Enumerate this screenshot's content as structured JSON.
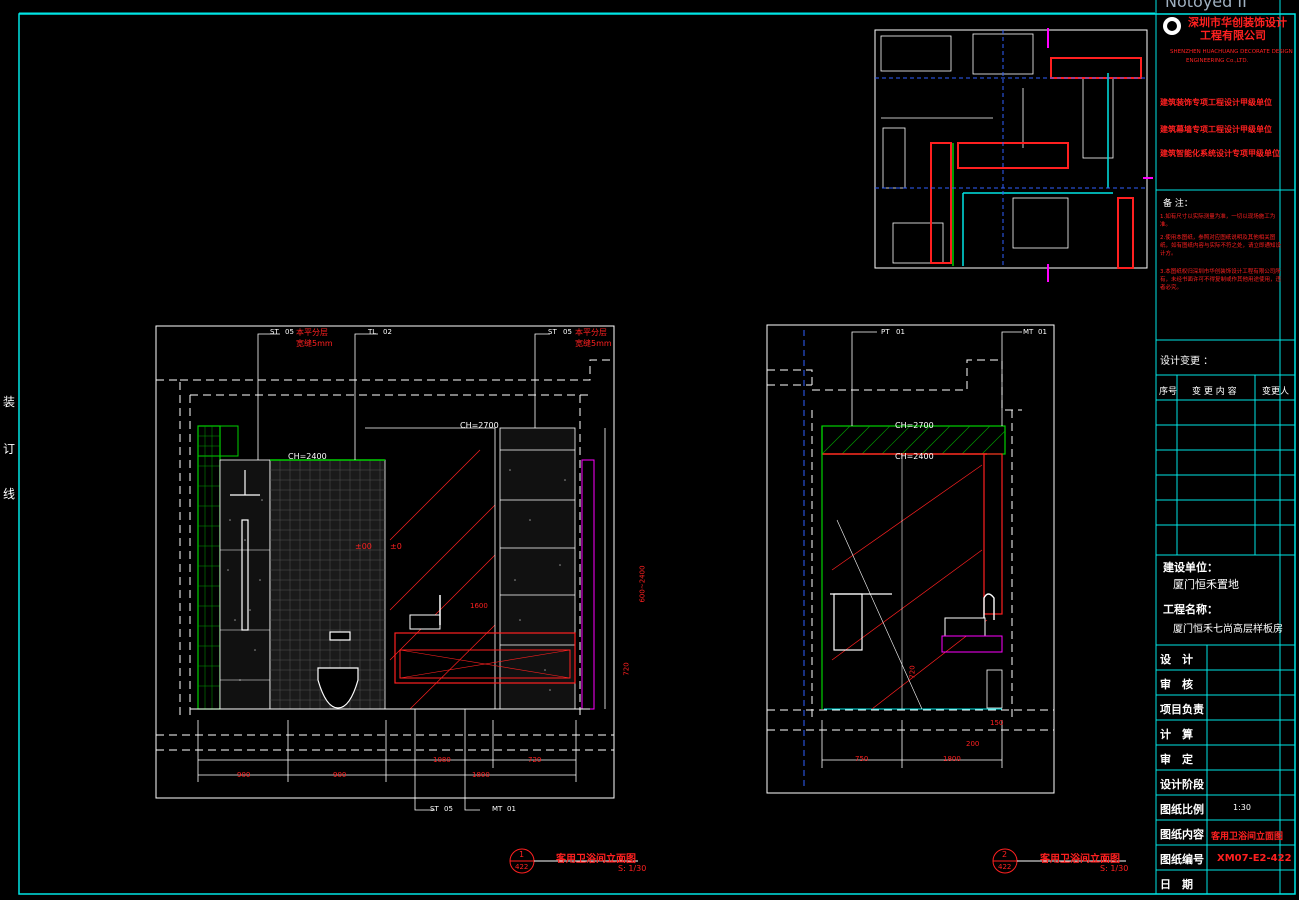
{
  "binding": {
    "c1": "装",
    "c2": "订",
    "c3": "线"
  },
  "titleblock": {
    "top_text": "Notoyed II",
    "company_cn_1": "深圳市华创装饰设计",
    "company_cn_2": "工程有限公司",
    "company_en_1": "SHENZHEN HUACHUANG DECORATE DESIGN",
    "company_en_2": "ENGINEERING Co.,LTD.",
    "approval_1": "建筑装饰专项工程设计甲级单位",
    "approval_2": "建筑幕墙专项工程设计甲级单位",
    "approval_3": "建筑智能化系统设计专项甲级单位",
    "notes_title": "备 注：",
    "note_1": "1.如有尺寸以实际测量为准，一切以现场施工为准。",
    "note_2": "2.使用本图纸，参照对应图纸说明及其他相关图纸，如有图纸内容与实际不符之处，请立即通知设计方。",
    "note_3": "3.本图纸权归深圳市华创装饰设计工程有限公司所有，未经书面许可不得复制或作其他用途使用，违者必究。",
    "change_title": "设计变更 ：",
    "change_cols": [
      "序号",
      "变 更 内 容",
      "变更人"
    ],
    "owner_label": "建设单位：",
    "owner_value": "厦门恒禾置地",
    "project_label": "工程名称：",
    "project_value": "厦门恒禾七尚高层样板房",
    "rows": [
      {
        "label": "设　计",
        "value": ""
      },
      {
        "label": "审　核",
        "value": ""
      },
      {
        "label": "项目负责",
        "value": ""
      },
      {
        "label": "计　算",
        "value": ""
      },
      {
        "label": "审　定",
        "value": ""
      },
      {
        "label": "设计阶段",
        "value": ""
      },
      {
        "label": "图纸比例",
        "value": "1:30"
      },
      {
        "label": "图纸内容",
        "value": "客用卫浴间立面图"
      },
      {
        "label": "图纸编号",
        "value": "XM07-E2-422"
      },
      {
        "label": "日　期",
        "value": ""
      }
    ]
  },
  "elevation1": {
    "tag_1": "本平分层",
    "tag_2": "宽缝5mm",
    "tag_3": "本平分层",
    "tag_4": "宽缝5mm",
    "ch_2400": "CH=2400",
    "ch_2700": "CH=2700",
    "dim_bottom": [
      "900",
      "900",
      "1080",
      "720",
      "1800"
    ],
    "dim_1600": "1600",
    "dim_720": "720",
    "dim_side": "600~2400",
    "callout_num": "1",
    "callout_sheet": "422",
    "title": "客用卫浴间立面图",
    "scale": "S: 1/30",
    "ref_st": "ST",
    "ref_tl": "TL",
    "ref_mt": "MT",
    "ref_01": "01",
    "ref_05": "05",
    "ref_02": "02",
    "mark_pm0": "±0",
    "mark_pm0b": "±00"
  },
  "elevation2": {
    "ch_2700": "CH=2700",
    "ch_2400": "CH=2400",
    "dim_bottom": [
      "750",
      "1800"
    ],
    "dim_720": "720",
    "dim_200": "200",
    "dim_150": "150",
    "callout_num": "2",
    "callout_sheet": "422",
    "title": "客用卫浴间立面图",
    "scale": "S: 1/30",
    "ref_pt": "PT",
    "ref_mt": "MT",
    "ref_01": "01"
  },
  "colors": {
    "border": "#00e5e5",
    "red": "#ff2020",
    "green": "#00d000",
    "white": "#ffffff",
    "magenta": "#ff00ff"
  }
}
